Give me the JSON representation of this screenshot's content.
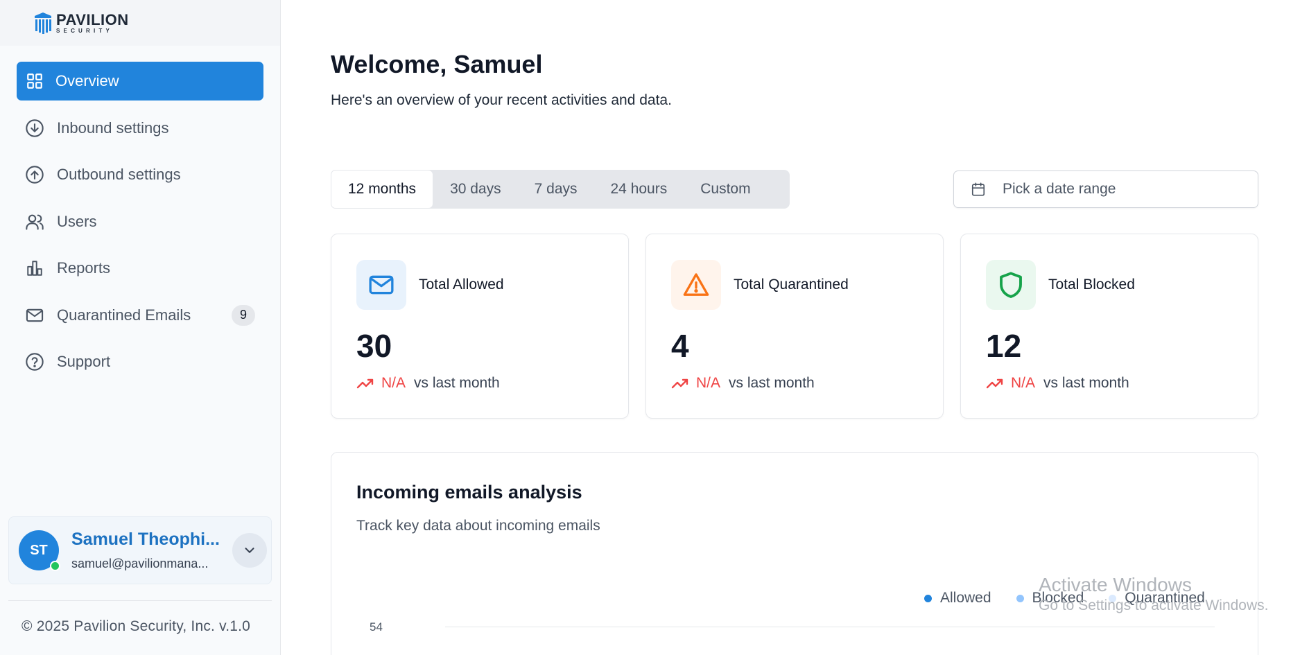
{
  "brand": {
    "name": "PAVILION",
    "tagline": "SECURITY"
  },
  "sidebar": {
    "items": [
      {
        "label": "Overview",
        "icon": "grid-icon",
        "active": true
      },
      {
        "label": "Inbound settings",
        "icon": "arrow-down-circle-icon"
      },
      {
        "label": "Outbound settings",
        "icon": "arrow-up-circle-icon"
      },
      {
        "label": "Users",
        "icon": "users-icon"
      },
      {
        "label": "Reports",
        "icon": "bar-chart-icon"
      },
      {
        "label": "Quarantined Emails",
        "icon": "mail-icon",
        "badge": "9"
      },
      {
        "label": "Support",
        "icon": "help-circle-icon"
      }
    ],
    "user": {
      "initials": "ST",
      "name": "Samuel Theophi...",
      "email": "samuel@pavilionmana...",
      "status_color": "#22c55e"
    },
    "copyright": "© 2025 Pavilion Security, Inc. v.1.0"
  },
  "main": {
    "welcome": "Welcome, Samuel",
    "subtitle": "Here's an overview of your recent activities and data.",
    "range_tabs": [
      {
        "label": "12 months",
        "active": true
      },
      {
        "label": "30 days"
      },
      {
        "label": "7 days"
      },
      {
        "label": "24 hours"
      },
      {
        "label": "Custom"
      }
    ],
    "date_picker": {
      "placeholder": "Pick a date range",
      "icon": "calendar-icon"
    },
    "stats": [
      {
        "title": "Total Allowed",
        "value": "30",
        "trend": "N/A",
        "trend_suffix": "vs last month",
        "icon": "mail-icon",
        "color": "#2184dc",
        "bg": "#e8f2fc"
      },
      {
        "title": "Total Quarantined",
        "value": "4",
        "trend": "N/A",
        "trend_suffix": "vs last month",
        "icon": "warning-icon",
        "color": "#f97316",
        "bg": "#fff4ec"
      },
      {
        "title": "Total Blocked",
        "value": "12",
        "trend": "N/A",
        "trend_suffix": "vs last month",
        "icon": "shield-icon",
        "color": "#16a34a",
        "bg": "#eaf8ef"
      }
    ],
    "analysis": {
      "title": "Incoming emails analysis",
      "subtitle": "Track key data about incoming emails",
      "legend": [
        {
          "name": "Allowed",
          "color": "#2184dc"
        },
        {
          "name": "Blocked",
          "color": "#93c5fd"
        },
        {
          "name": "Quarantined",
          "color": "#dbeafe"
        }
      ],
      "y_tick_top": "54"
    }
  },
  "watermark": {
    "line1": "Activate Windows",
    "line2": "Go to Settings to activate Windows."
  },
  "colors": {
    "accent": "#2184dc",
    "danger": "#ef4444"
  }
}
